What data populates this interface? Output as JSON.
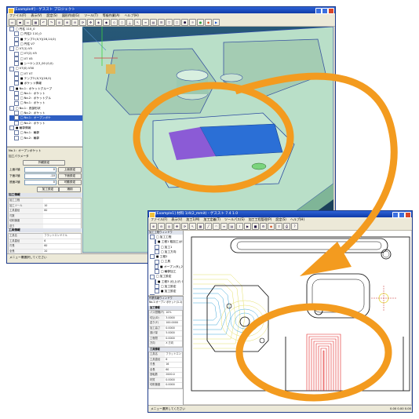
{
  "win1": {
    "title": "[Example#] - ゲススト プロジェクト",
    "menu": [
      "ファイル(F)",
      "表示(V)",
      "設定(S)",
      "図形作成(G)",
      "ツール(T)",
      "等級作業(A)",
      "ヘルプ(H)"
    ],
    "tree_items": [
      {
        "label": "□ 円柱 110_0",
        "sel": false
      },
      {
        "label": "□ 円柱2 110_0",
        "sel": false
      },
      {
        "label": "■ テンプ3 (X,Y)(16,14,0)",
        "sel": false
      },
      {
        "label": "□ 円柱 V7",
        "sel": false
      },
      {
        "label": "□ V7(1) V5",
        "sel": false
      },
      {
        "label": "□ V7(2) V5",
        "sel": false
      },
      {
        "label": "□ V7 V5",
        "sel": false
      },
      {
        "label": "■ シーケンス3_00 (0,0)",
        "sel": false
      },
      {
        "label": "□ V7(0) V50",
        "sel": false
      },
      {
        "label": "□ V7 V7",
        "sel": false
      },
      {
        "label": "■ テンプ3 (X,Y)(16,0)",
        "sel": false
      },
      {
        "label": "■ ポケット情報",
        "sel": false
      },
      {
        "label": "■ No.1：ポケットグループ",
        "sel": false
      },
      {
        "label": "□ No.1：ポケット",
        "sel": false
      },
      {
        "label": "□ No.2：ポケットグル",
        "sel": false
      },
      {
        "label": "□ No.1：ポケット",
        "sel": false
      },
      {
        "label": "□ No.1：底部形状",
        "sel": false
      },
      {
        "label": "□ No.2：ポケット",
        "sel": false
      },
      {
        "label": "□ No.1：オープンポケ",
        "sel": true
      },
      {
        "label": "□ No.2：ポケット",
        "sel": false
      },
      {
        "label": "■ 輪郭情報",
        "sel": false
      },
      {
        "label": "□ No.1：輪郭",
        "sel": false
      },
      {
        "label": "□ No.2：輪郭",
        "sel": false
      }
    ],
    "panel_title": "No.1：オープンポケット",
    "panel_subtitle": "加工パラメータ",
    "shape_btn": "外観設定",
    "fields": [
      {
        "label": "上面Z値",
        "value": "0",
        "btn": "上面設定"
      },
      {
        "label": "下面Z値",
        "value": "-10",
        "btn": "下面設定"
      },
      {
        "label": "底面Z値",
        "value": "0",
        "btn": "可動設定"
      }
    ],
    "btn_a": "加工設定",
    "btn_b": "適用",
    "sect1": "加工情報",
    "grid1": [
      [
        "加工工程",
        ""
      ],
      [
        "加工ツール",
        "10"
      ],
      [
        "工具直径",
        "60"
      ],
      [
        "刃数",
        ""
      ],
      [
        "切削速度",
        ""
      ],
      [
        "送り",
        ""
      ],
      [
        "切込み",
        ""
      ]
    ],
    "sect2": "工具情報",
    "grid2": [
      [
        "工具名",
        "フラットエンドミル"
      ],
      [
        "工具直径",
        "6"
      ],
      [
        "刃長",
        "60"
      ],
      [
        "全長",
        "20"
      ],
      [
        "材質",
        ""
      ],
      [
        "回転数",
        ""
      ]
    ],
    "status": "メニュー欄選択してください"
  },
  "win2": {
    "title": "[Example1] 材料 1/4(2_mmit) - ゲススト 7.4 1.0",
    "menu": [
      "ファイル(F)",
      "表示(V)",
      "加工1(M)",
      "加工定義(T)",
      "ツールパス(S)",
      "加工工程管理(P)",
      "設定(S)",
      "ヘルプ(H)"
    ],
    "tree_header": "加工工程ウィンドウ",
    "tree_items": [
      {
        "label": "□ 加工工程",
        "sel": false
      },
      {
        "label": "■ 工程1 粗加工(ポケット)",
        "sel": false
      },
      {
        "label": "□ 加工1",
        "sel": false
      },
      {
        "label": "□ 加工方向",
        "sel": false
      },
      {
        "label": "■ 工程2",
        "sel": false
      },
      {
        "label": "□ 工具",
        "sel": false
      },
      {
        "label": "■ オープン(R)_2",
        "sel": false
      },
      {
        "label": "□ 輪郭加工",
        "sel": false
      },
      {
        "label": "□ 加工設定",
        "sel": false
      },
      {
        "label": "■ 工程3 (仕上げ) 0",
        "sel": false
      },
      {
        "label": "□ 加工設定",
        "sel": false
      },
      {
        "label": "■ 加工設定",
        "sel": false
      },
      {
        "label": "■ 工程4",
        "sel": false
      },
      {
        "label": "□ 加工1",
        "sel": false
      },
      {
        "label": "□ 加工設定",
        "sel": false
      }
    ],
    "prop_header": "作業情報ウィンドウ",
    "prop_title": "No.1:オープン ポケット(1-1)",
    "sect1": "加工情報",
    "grid1": [
      [
        "パス間隔(P)",
        "10%"
      ],
      [
        "切込(D)",
        "3.0000"
      ],
      [
        "送り(F)",
        "100.0000"
      ],
      [
        "加工高さ",
        "0.0000"
      ],
      [
        "逃げ量",
        "5.0000"
      ],
      [
        "工程間",
        "0.0000"
      ],
      [
        "方向",
        "X 方向"
      ]
    ],
    "sect2": "工具情報",
    "grid2": [
      [
        "工具名",
        "フラットエンドミル"
      ],
      [
        "工具直径",
        "6"
      ],
      [
        "刃長",
        "16"
      ],
      [
        "全長",
        "60"
      ],
      [
        "回転数",
        "2000.0"
      ],
      [
        "材質",
        "0.0000"
      ],
      [
        "切削速度",
        "0.0000"
      ]
    ],
    "status": "メニュー選択してください",
    "status_right": "0.00 0.00  0.00"
  }
}
